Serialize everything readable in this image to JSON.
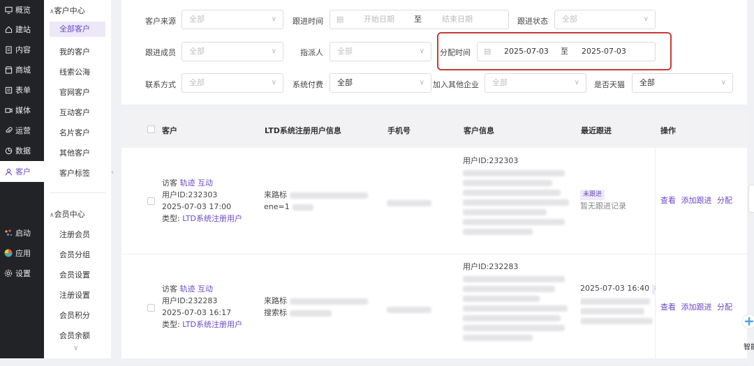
{
  "nav": {
    "items": [
      {
        "label": "概览",
        "icon": "monitor-icon"
      },
      {
        "label": "建站",
        "icon": "home-icon"
      },
      {
        "label": "内容",
        "icon": "document-icon"
      },
      {
        "label": "商城",
        "icon": "shop-icon"
      },
      {
        "label": "表单",
        "icon": "form-icon"
      },
      {
        "label": "媒体",
        "icon": "video-icon"
      },
      {
        "label": "运营",
        "icon": "paperclip-icon"
      },
      {
        "label": "数据",
        "icon": "chart-icon"
      },
      {
        "label": "客户",
        "icon": "user-icon"
      }
    ],
    "bottom": [
      {
        "label": "启动",
        "icon": "launch-icon"
      },
      {
        "label": "应用",
        "icon": "apps-icon"
      },
      {
        "label": "设置",
        "icon": "gear-icon"
      }
    ]
  },
  "sub": {
    "section1": "客户中心",
    "items1": [
      "全部客户",
      "我的客户",
      "线索公海",
      "官网客户",
      "互动客户",
      "名片客户",
      "其他客户",
      "客户标签"
    ],
    "section2": "会员中心",
    "items2": [
      "注册会员",
      "会员分组",
      "会员设置",
      "注册设置",
      "会员积分",
      "会员余额"
    ]
  },
  "filters": {
    "source_label": "客户来源",
    "source_value": "全部",
    "follow_time_label": "跟进时间",
    "start_placeholder": "开始日期",
    "to": "至",
    "end_placeholder": "结束日期",
    "follow_status_label": "跟进状态",
    "follow_status_value": "全部",
    "follow_member_label": "跟进成员",
    "follow_member_value": "全部",
    "assignee_label": "指派人",
    "assignee_value": "全部",
    "assign_time_label": "分配时间",
    "assign_start": "2025-07-03",
    "assign_end": "2025-07-03",
    "contact_label": "联系方式",
    "contact_value": "全部",
    "paid_label": "系统付费",
    "paid_value": "全部",
    "other_ent_label": "加入其他企业",
    "other_ent_value": "全部",
    "tmall_label": "是否天猫",
    "tmall_value": "全部"
  },
  "table": {
    "headers": [
      "客户",
      "LTD系统注册用户信息",
      "手机号",
      "客户信息",
      "最近跟进",
      "操作"
    ],
    "rows": [
      {
        "visitor": "访客",
        "track": "轨迹",
        "interact": "互动",
        "user_id": "用户ID:232303",
        "time": "2025-07-03 17:00",
        "type_label": "类型:",
        "type_value": "LTD系统注册用户",
        "ltd_line1": "来路标",
        "ltd_line2": "ene=1",
        "info_id": "用户ID:232303",
        "follow_tag": "未跟进",
        "follow_text": "暂无跟进记录",
        "ops": [
          "查看",
          "添加跟进",
          "分配"
        ]
      },
      {
        "visitor": "访客",
        "track": "轨迹",
        "interact": "互动",
        "user_id": "用户ID:232283",
        "time": "2025-07-03 16:17",
        "type_label": "类型:",
        "type_value": "LTD系统注册用户",
        "ltd_line1": "来路标",
        "ltd_line2": "搜索标",
        "info_id": "用户ID:232283",
        "follow_time": "2025-07-03 16:40",
        "follow_tag2": "初",
        "ops": [
          "查看",
          "添加跟进",
          "分配"
        ]
      }
    ]
  },
  "helper_label": "智能"
}
